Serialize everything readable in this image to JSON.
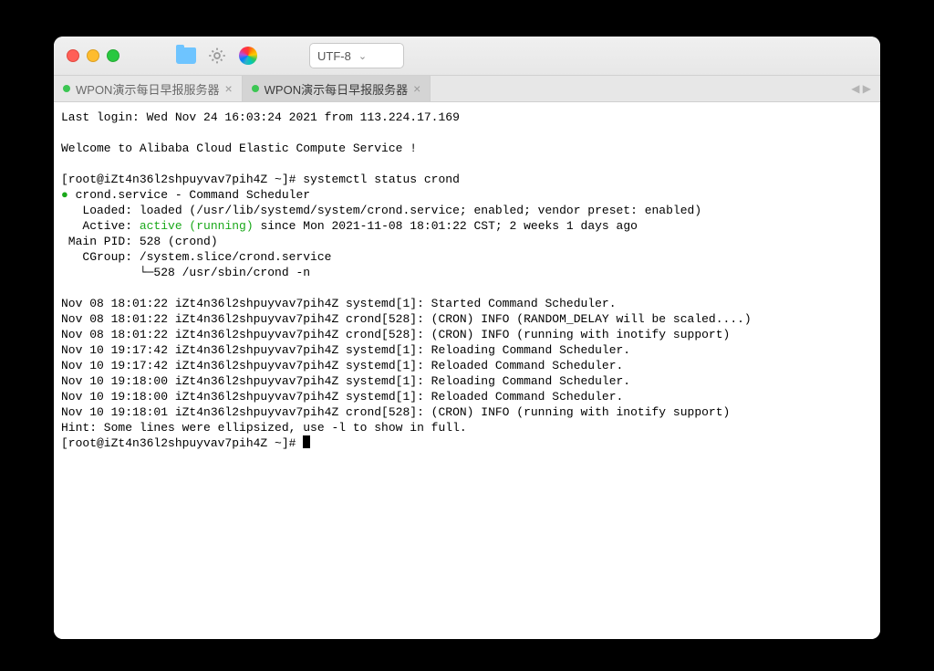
{
  "toolbar": {
    "encoding_label": "UTF-8"
  },
  "tabs": [
    {
      "label": "WPON演示每日早报服务器",
      "active": false
    },
    {
      "label": "WPON演示每日早报服务器",
      "active": true
    }
  ],
  "terminal": {
    "last_login": "Last login: Wed Nov 24 16:03:24 2021 from 113.224.17.169",
    "welcome": "Welcome to Alibaba Cloud Elastic Compute Service !",
    "prompt1_prefix": "[root@iZt4n36l2shpuyvav7pih4Z ~]# ",
    "cmd1": "systemctl status crond",
    "bullet": "●",
    "svc_line": " crond.service - Command Scheduler",
    "loaded": "   Loaded: loaded (/usr/lib/systemd/system/crond.service; enabled; vendor preset: enabled)",
    "active_prefix": "   Active: ",
    "active_state": "active (running)",
    "active_suffix": " since Mon 2021-11-08 18:01:22 CST; 2 weeks 1 days ago",
    "main_pid": " Main PID: 528 (crond)",
    "cgroup1": "   CGroup: /system.slice/crond.service",
    "cgroup2": "           └─528 /usr/sbin/crond -n",
    "logs": [
      "Nov 08 18:01:22 iZt4n36l2shpuyvav7pih4Z systemd[1]: Started Command Scheduler.",
      "Nov 08 18:01:22 iZt4n36l2shpuyvav7pih4Z crond[528]: (CRON) INFO (RANDOM_DELAY will be scaled....)",
      "Nov 08 18:01:22 iZt4n36l2shpuyvav7pih4Z crond[528]: (CRON) INFO (running with inotify support)",
      "Nov 10 19:17:42 iZt4n36l2shpuyvav7pih4Z systemd[1]: Reloading Command Scheduler.",
      "Nov 10 19:17:42 iZt4n36l2shpuyvav7pih4Z systemd[1]: Reloaded Command Scheduler.",
      "Nov 10 19:18:00 iZt4n36l2shpuyvav7pih4Z systemd[1]: Reloading Command Scheduler.",
      "Nov 10 19:18:00 iZt4n36l2shpuyvav7pih4Z systemd[1]: Reloaded Command Scheduler.",
      "Nov 10 19:18:01 iZt4n36l2shpuyvav7pih4Z crond[528]: (CRON) INFO (running with inotify support)"
    ],
    "hint": "Hint: Some lines were ellipsized, use -l to show in full.",
    "prompt2": "[root@iZt4n36l2shpuyvav7pih4Z ~]# "
  }
}
